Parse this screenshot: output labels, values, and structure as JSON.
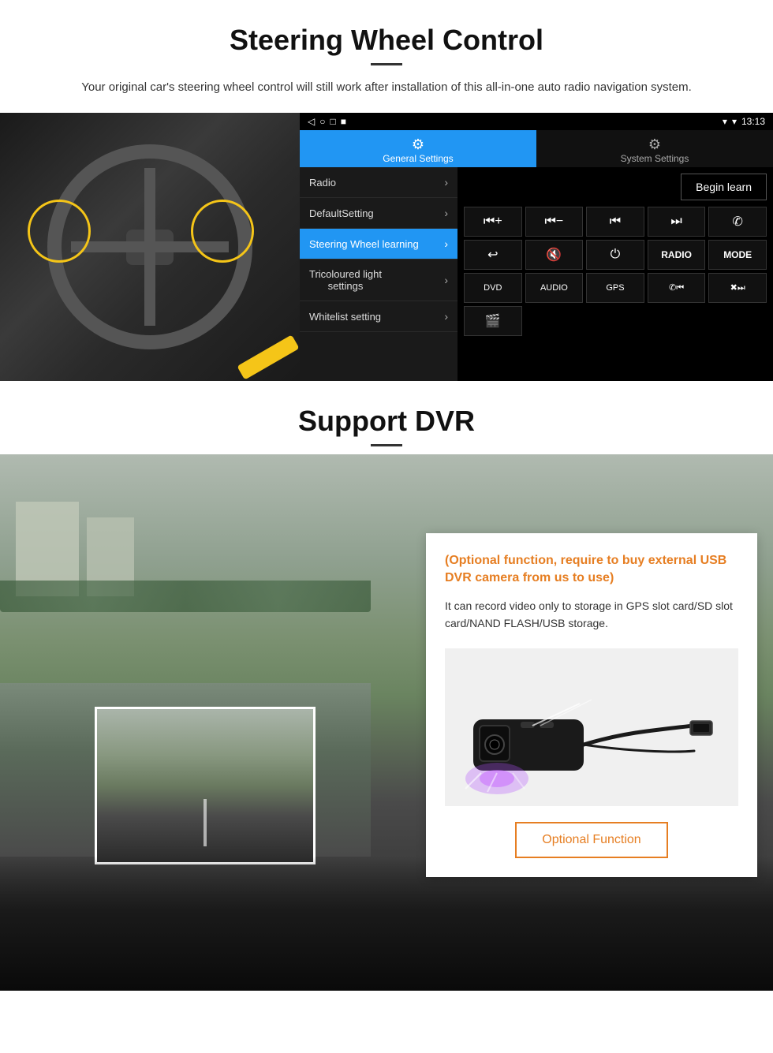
{
  "section1": {
    "title": "Steering Wheel Control",
    "subtitle": "Your original car's steering wheel control will still work after installation of this all-in-one auto radio navigation system.",
    "android_ui": {
      "statusbar": {
        "time": "13:13",
        "signal_icon": "▼",
        "wifi_icon": "▾"
      },
      "nav_buttons": [
        "◁",
        "○",
        "□",
        "■"
      ],
      "tabs": [
        {
          "label": "General Settings",
          "active": true
        },
        {
          "label": "System Settings",
          "active": false
        }
      ],
      "menu_items": [
        {
          "label": "Radio",
          "active": false
        },
        {
          "label": "DefaultSetting",
          "active": false
        },
        {
          "label": "Steering Wheel learning",
          "active": true
        },
        {
          "label": "Tricoloured light settings",
          "active": false
        },
        {
          "label": "Whitelist setting",
          "active": false
        }
      ],
      "begin_learn_label": "Begin learn",
      "control_buttons_row1": [
        "⏮+",
        "⏮−",
        "⏮⏮",
        "⏭⏭",
        "📞"
      ],
      "control_buttons_row2": [
        "↩",
        "🔇",
        "⏻",
        "RADIO",
        "MODE"
      ],
      "control_buttons_row3": [
        "DVD",
        "AUDIO",
        "GPS",
        "📞⏮",
        "✖⏭"
      ],
      "control_buttons_row4": [
        "🎬"
      ]
    }
  },
  "section2": {
    "title": "Support DVR",
    "info_card": {
      "title": "(Optional function, require to buy external USB DVR camera from us to use)",
      "body": "It can record video only to storage in GPS slot card/SD slot card/NAND FLASH/USB storage.",
      "optional_btn_label": "Optional Function"
    }
  },
  "icons": {
    "gear": "⚙",
    "settings": "⚙",
    "chevron_right": "›",
    "back": "◁",
    "home": "○",
    "recent": "□",
    "menu": "■",
    "signal": "▾",
    "wifi": "▾",
    "phone": "✆",
    "mute": "🔇",
    "power": "⏻",
    "media_prev_plus": "⏮+",
    "media_prev_minus": "⏮−",
    "skip_back": "⏮",
    "skip_fwd": "⏭",
    "hang_up": "↩",
    "film": "🎬"
  },
  "colors": {
    "accent_blue": "#2196F3",
    "accent_orange": "#e67e22",
    "black": "#000000",
    "white": "#ffffff",
    "dark_bg": "#1a1a1a",
    "medium_bg": "#111111"
  }
}
